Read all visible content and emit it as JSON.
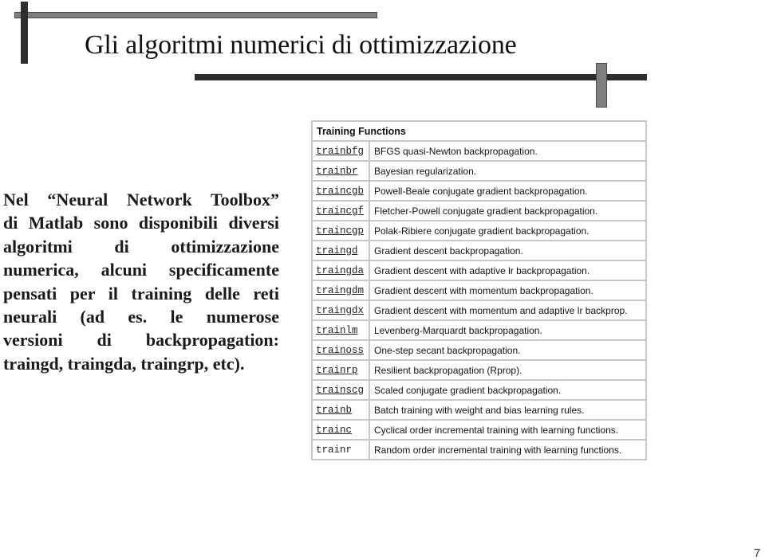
{
  "slide": {
    "title": "Gli algoritmi numerici di ottimizzazione",
    "page_number": "7"
  },
  "body_text": {
    "lines": [
      "Nel “Neural Network Toolbox”",
      "di Matlab sono disponibili diversi",
      "algoritmi di ottimizzazione",
      "numerica, alcuni specificamente",
      "pensati per il training delle reti",
      "neurali (ad es. le numerose",
      "versioni di backpropagation:",
      "traingd, traingda,  traingrp, etc)."
    ]
  },
  "table": {
    "header": "Training Functions",
    "rows": [
      {
        "name": "trainbfg",
        "desc": "BFGS quasi-Newton backpropagation.",
        "link": true
      },
      {
        "name": "trainbr",
        "desc": "Bayesian regularization.",
        "link": true
      },
      {
        "name": "traincgb",
        "desc": "Powell-Beale conjugate gradient backpropagation.",
        "link": true
      },
      {
        "name": "traincgf",
        "desc": "Fletcher-Powell conjugate gradient backpropagation.",
        "link": true
      },
      {
        "name": "traincgp",
        "desc": "Polak-Ribiere conjugate gradient backpropagation.",
        "link": true
      },
      {
        "name": "traingd",
        "desc": "Gradient descent backpropagation.",
        "link": true
      },
      {
        "name": "traingda",
        "desc": "Gradient descent with adaptive lr backpropagation.",
        "link": true
      },
      {
        "name": "traingdm",
        "desc": "Gradient descent with momentum backpropagation.",
        "link": true
      },
      {
        "name": "traingdx",
        "desc": "Gradient descent with momentum and adaptive lr backprop.",
        "link": true
      },
      {
        "name": "trainlm",
        "desc": "Levenberg-Marquardt backpropagation.",
        "link": true
      },
      {
        "name": "trainoss",
        "desc": "One-step secant backpropagation.",
        "link": true
      },
      {
        "name": "trainrp",
        "desc": "Resilient backpropagation (Rprop).",
        "link": true
      },
      {
        "name": "trainscg",
        "desc": "Scaled conjugate gradient backpropagation.",
        "link": true
      },
      {
        "name": "trainb",
        "desc": "Batch training with weight and bias learning rules.",
        "link": true
      },
      {
        "name": "trainc",
        "desc": "Cyclical order incremental training with learning functions.",
        "link": true
      },
      {
        "name": "trainr",
        "desc": "Random order incremental training with learning functions.",
        "link": false
      }
    ]
  }
}
